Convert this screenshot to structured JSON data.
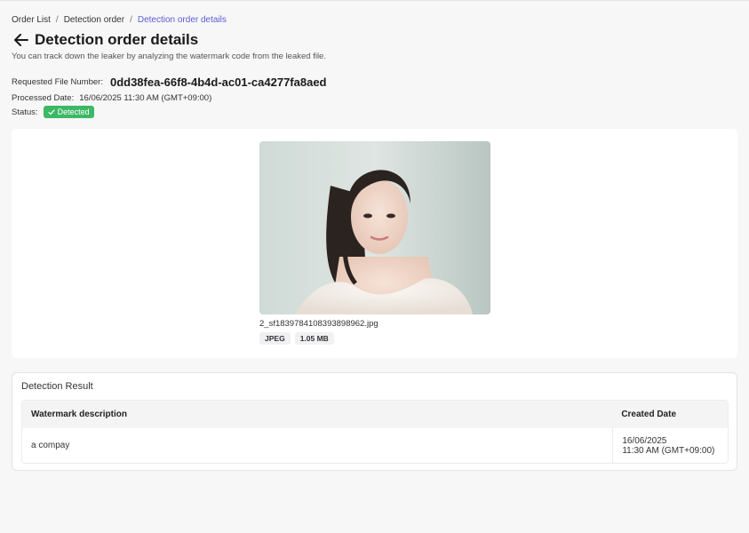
{
  "breadcrumb": {
    "items": [
      "Order List",
      "Detection order",
      "Detection order details"
    ],
    "separator": "/"
  },
  "header": {
    "title": "Detection order details",
    "subtitle": "You can track down the leaker by analyzing the watermark code from the leaked file."
  },
  "meta": {
    "requested_label": "Requested File Number:",
    "requested_value": "0dd38fea-66f8-4b4d-ac01-ca4277fa8aed",
    "processed_label": "Processed Date:",
    "processed_value": "16/06/2025 11:30 AM (GMT+09:00)",
    "status_label": "Status:",
    "status_value": "Detected"
  },
  "file": {
    "name": "2_sf1839784108393898962.jpg",
    "type": "JPEG",
    "size": "1.05 MB"
  },
  "result": {
    "title": "Detection Result",
    "columns": [
      "Watermark description",
      "Created Date"
    ],
    "rows": [
      {
        "description": "a compay",
        "date_line1": "16/06/2025",
        "date_line2": "11:30 AM (GMT+09:00)"
      }
    ]
  },
  "colors": {
    "accent": "#5b5bd6",
    "status_green": "#3db865",
    "background": "#f7f7f8"
  },
  "icons": {
    "back": "arrow-left-icon",
    "status": "check-icon"
  }
}
